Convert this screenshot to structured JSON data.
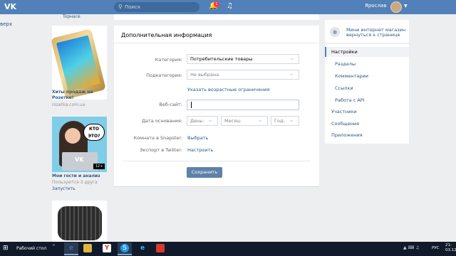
{
  "header": {
    "logo_text": "VK",
    "search_placeholder": "Поиск",
    "notifications_count": "1",
    "username": "Ярослав"
  },
  "left_nav": {
    "partial_text": "верх"
  },
  "ads": {
    "top_label": "Topнасе",
    "ad1": {
      "title": "Хиты продаж на Розетке!",
      "source": "rozetka.com.ua"
    },
    "ad2": {
      "bubble_text": "КТО ЭТО?",
      "badge": "12+",
      "title": "Мои гости и анализ",
      "subtitle": "Пользуются 3 друга",
      "launch": "Запустить"
    }
  },
  "form": {
    "title": "Дополнительная информация",
    "category_label": "Категория:",
    "category_value": "Потребительские товары",
    "subcategory_label": "Подкатегория:",
    "subcategory_value": "Не выбрана",
    "age_link": "Указать возрастные ограничения",
    "website_label": "Веб-сайт:",
    "founded_label": "Дата основания:",
    "day_placeholder": "День:",
    "month_placeholder": "Месяц:",
    "year_placeholder": "Год:",
    "snapster_label": "Комната в Snapster:",
    "snapster_action": "Выбрать",
    "twitter_label": "Экспорт в Twitter:",
    "twitter_action": "Настроить",
    "save_label": "Сохранить"
  },
  "right_menu": {
    "group_name": "Мини интернет магазин",
    "back_link": "вернуться к странице",
    "items": [
      {
        "label": "Настройки",
        "active": true,
        "level": "main"
      },
      {
        "label": "Разделы",
        "level": "sub"
      },
      {
        "label": "Комментарии",
        "level": "sub"
      },
      {
        "label": "Ссылки",
        "level": "sub"
      },
      {
        "label": "Работа с API",
        "level": "sub"
      },
      {
        "label": "Участники",
        "level": "main"
      },
      {
        "label": "Сообщения",
        "level": "main"
      },
      {
        "label": "Приложения",
        "level": "main"
      }
    ]
  },
  "taskbar": {
    "desktop_label": "Рабочий стол",
    "lang": "РУС",
    "time": "21:",
    "date": "03.12"
  },
  "colors": {
    "header_blue": "#5181b8",
    "link_blue": "#2a5885",
    "button_blue": "#5e81a8",
    "taskbar": "#101a2a"
  }
}
